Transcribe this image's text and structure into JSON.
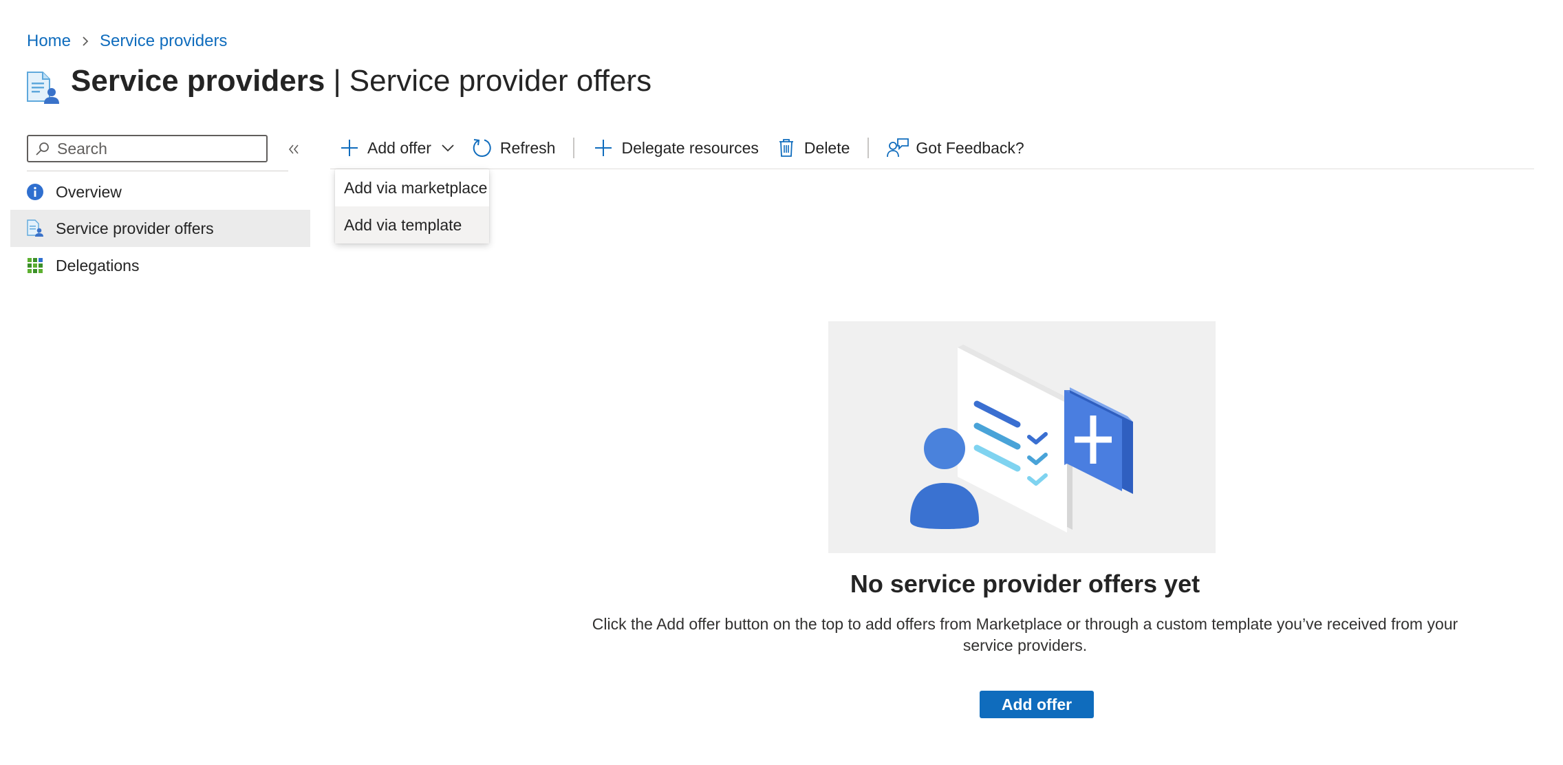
{
  "breadcrumb": {
    "home": "Home",
    "current": "Service providers"
  },
  "header": {
    "title_main": "Service providers",
    "title_separator": "|",
    "title_sub": "Service provider offers",
    "more": "···"
  },
  "nav": {
    "search_placeholder": "Search",
    "items": [
      {
        "label": "Overview",
        "icon": "info-icon"
      },
      {
        "label": "Service provider offers",
        "icon": "offers-icon",
        "selected": true
      },
      {
        "label": "Delegations",
        "icon": "grid-icon"
      }
    ]
  },
  "toolbar": {
    "add_offer": "Add offer",
    "refresh": "Refresh",
    "delegate": "Delegate resources",
    "delete": "Delete",
    "feedback": "Got Feedback?"
  },
  "dropdown": {
    "items": [
      "Add via marketplace",
      "Add via template"
    ]
  },
  "empty_state": {
    "title": "No service provider offers yet",
    "description": "Click the Add offer button on the top to add offers from Marketplace or through a custom template you’ve received from your service providers.",
    "button": "Add offer"
  },
  "colors": {
    "accent": "#0f6cbd",
    "selected_bg": "#ebebeb",
    "illustration_bg": "#f0f0f0"
  }
}
